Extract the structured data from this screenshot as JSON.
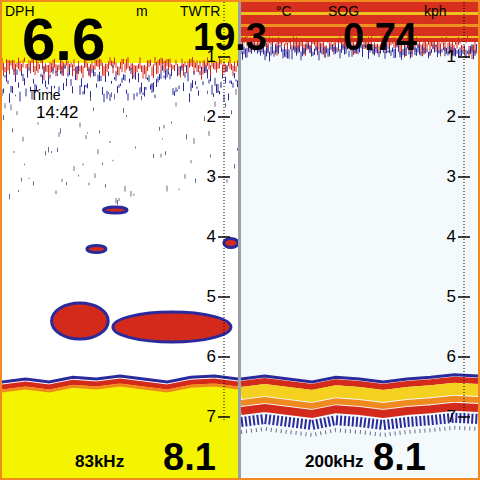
{
  "readouts": [
    {
      "label": "DPH",
      "unit": "m",
      "value": "6.6"
    },
    {
      "label": "TWTR",
      "unit": "°C",
      "value": "19.3"
    },
    {
      "label": "SOG",
      "unit": "kph",
      "value": "0.74"
    }
  ],
  "time": {
    "label": "Time",
    "value": "14:42"
  },
  "panels": [
    {
      "kind": "low",
      "frequency": "83kHz",
      "range": "8.1",
      "scale": [
        "1",
        "2",
        "3",
        "4",
        "5",
        "6",
        "7"
      ],
      "surface_depth": 1.1,
      "bottom_depth": [
        6.5,
        6.45,
        6.5,
        6.42,
        6.45,
        6.4,
        6.45,
        6.5,
        6.42,
        6.4,
        6.45
      ],
      "targets": [
        {
          "depth": 5.4,
          "x": 0.33,
          "width": 0.24,
          "height": 0.6
        },
        {
          "depth": 5.5,
          "x": 0.72,
          "width": 0.5,
          "height": 0.5
        },
        {
          "depth": 4.2,
          "x": 0.4,
          "width": 0.08,
          "height": 0.12
        },
        {
          "depth": 3.55,
          "x": 0.48,
          "width": 0.1,
          "height": 0.1
        },
        {
          "depth": 4.1,
          "x": 0.97,
          "width": 0.06,
          "height": 0.15
        }
      ]
    },
    {
      "kind": "high",
      "frequency": "200kHz",
      "range": "8.1",
      "scale": [
        "1",
        "2",
        "3",
        "4",
        "5",
        "6",
        "7"
      ],
      "surface_depth": 0.75,
      "bottom_depth": [
        6.45,
        6.4,
        6.45,
        6.5,
        6.42,
        6.45,
        6.5,
        6.45,
        6.42,
        6.38,
        6.4
      ],
      "targets": []
    }
  ]
}
